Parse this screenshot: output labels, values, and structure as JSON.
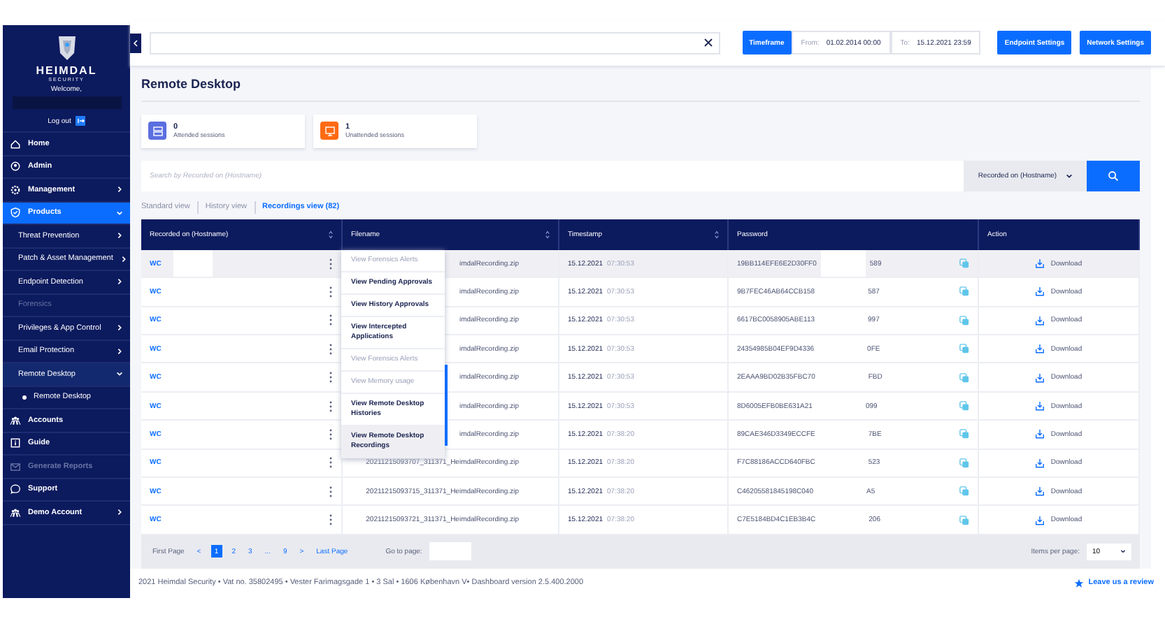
{
  "sidebar": {
    "brand": "HEIMDAL",
    "brand_sub": "SECURITY",
    "welcome": "Welcome,",
    "logout": "Log out",
    "items": [
      {
        "label": "Home",
        "selected": false,
        "disabled": false
      },
      {
        "label": "Admin",
        "selected": false,
        "disabled": false
      },
      {
        "label": "Management",
        "selected": false,
        "disabled": false,
        "expanded": false
      },
      {
        "label": "Products",
        "selected": true,
        "disabled": false,
        "expanded": true,
        "children": [
          {
            "label": "Threat Prevention",
            "selected": false,
            "disabled": false,
            "expanded": false
          },
          {
            "label": "Patch & Asset Management",
            "selected": false,
            "disabled": false,
            "expanded": false
          },
          {
            "label": "Endpoint Detection",
            "selected": false,
            "disabled": false,
            "expanded": false
          },
          {
            "label": "Forensics",
            "selected": false,
            "disabled": true
          },
          {
            "label": "Privileges & App Control",
            "selected": false,
            "disabled": false,
            "expanded": false
          },
          {
            "label": "Email Protection",
            "selected": false,
            "disabled": false,
            "expanded": false
          },
          {
            "label": "Remote Desktop",
            "selected": true,
            "disabled": false,
            "expanded": true,
            "children": [
              {
                "label": "Remote Desktop",
                "selected": true,
                "disabled": false
              }
            ]
          }
        ]
      },
      {
        "label": "Accounts",
        "selected": false,
        "disabled": false
      },
      {
        "label": "Guide",
        "selected": false,
        "disabled": false
      },
      {
        "label": "Generate Reports",
        "selected": false,
        "disabled": true
      },
      {
        "label": "Support",
        "selected": false,
        "disabled": false
      },
      {
        "label": "Demo Account",
        "selected": false,
        "disabled": false,
        "expanded": false
      }
    ]
  },
  "top_bar": {
    "timeframe": "Timeframe",
    "from_label": "From:",
    "from_value": "01.02.2014 00:00",
    "to_label": "To:",
    "to_value": "15.12.2021 23:59",
    "buttons": [
      "Endpoint Settings",
      "Network Settings"
    ]
  },
  "page_title": "Remote Desktop",
  "stats": [
    {
      "value": "0",
      "label": "Attended sessions",
      "color": "#5b6fe0"
    },
    {
      "value": "1",
      "label": "Unattended sessions",
      "color": "#ff6a13"
    }
  ],
  "search": {
    "placeholder": "Search by Recorded on (Hostname)",
    "filter": "Recorded on (Hostname)"
  },
  "tabs": [
    {
      "label": "Standard view",
      "selected": false
    },
    {
      "label": "History view",
      "selected": false
    },
    {
      "label": "Recordings view (82)",
      "selected": true
    }
  ],
  "table": {
    "columns": [
      "Recorded on (Hostname)",
      "Filename",
      "Timestamp",
      "Password",
      "Action"
    ],
    "rows": [
      {
        "hostname": "WC",
        "filename": "imdalRecording.zip",
        "date": "15.12.2021",
        "time": "07:30:53",
        "password_start": "19BB114EFE6E2D30FF0",
        "password_end": "589",
        "action": "Download",
        "highlighted": true
      },
      {
        "hostname": "WC",
        "filename": "imdalRecording.zip",
        "date": "15.12.2021",
        "time": "07:30:53",
        "password_start": "9B7FEC46AB64CCB158",
        "password_end": "587",
        "action": "Download",
        "highlighted": false
      },
      {
        "hostname": "WC",
        "filename": "imdalRecording.zip",
        "date": "15.12.2021",
        "time": "07:30:53",
        "password_start": "6617BC0058905ABE113",
        "password_end": "997",
        "action": "Download",
        "highlighted": false
      },
      {
        "hostname": "WC",
        "filename": "imdalRecording.zip",
        "date": "15.12.2021",
        "time": "07:30:53",
        "password_start": "24354985B04EF9D4336",
        "password_end": "0FE",
        "action": "Download",
        "highlighted": false
      },
      {
        "hostname": "WC",
        "filename": "imdalRecording.zip",
        "date": "15.12.2021",
        "time": "07:30:53",
        "password_start": "2EAAA9BD02B35FBC70",
        "password_end": "FBD",
        "action": "Download",
        "highlighted": false
      },
      {
        "hostname": "WC",
        "filename": "imdalRecording.zip",
        "date": "15.12.2021",
        "time": "07:30:53",
        "password_start": "8D6005EFB0BE631A21",
        "password_end": "099",
        "action": "Download",
        "highlighted": false
      },
      {
        "hostname": "WC",
        "filename": "imdalRecording.zip",
        "date": "15.12.2021",
        "time": "07:38:20",
        "password_start": "89CAE346D3349ECCFE",
        "password_end": "7BE",
        "action": "Download",
        "highlighted": false
      },
      {
        "hostname": "WC",
        "filename": "20211215093707_311371_HeimdalRecording.zip",
        "date": "15.12.2021",
        "time": "07:38:20",
        "password_start": "F7C88186ACCD640FBC",
        "password_end": "523",
        "action": "Download",
        "highlighted": false
      },
      {
        "hostname": "WC",
        "filename": "20211215093715_311371_HeimdalRecording.zip",
        "date": "15.12.2021",
        "time": "07:38:20",
        "password_start": "C46205581845198C040",
        "password_end": "A5",
        "action": "Download",
        "highlighted": false
      },
      {
        "hostname": "WC",
        "filename": "20211215093721_311371_HeimdalRecording.zip",
        "date": "15.12.2021",
        "time": "07:38:20",
        "password_start": "C7E5184BD4C1EB3B4C",
        "password_end": "206",
        "action": "Download",
        "highlighted": false
      }
    ]
  },
  "row_menu": [
    {
      "label": "View Forensics Alerts",
      "disabled": true,
      "selected": false
    },
    {
      "label": "View Pending Approvals",
      "disabled": false,
      "selected": false
    },
    {
      "label": "View History Approvals",
      "disabled": false,
      "selected": false
    },
    {
      "label": "View Intercepted Applications",
      "disabled": false,
      "selected": false
    },
    {
      "label": "View Forensics Alerts",
      "disabled": true,
      "selected": false
    },
    {
      "label": "View Memory usage",
      "disabled": true,
      "selected": false
    },
    {
      "label": "View Remote Desktop Histories",
      "disabled": false,
      "selected": false
    },
    {
      "label": "View Remote Desktop Recordings",
      "disabled": false,
      "selected": true
    }
  ],
  "pagination": {
    "first": "First Page",
    "prev": "<",
    "pages": [
      {
        "label": "1",
        "selected": true
      },
      {
        "label": "2",
        "selected": false
      },
      {
        "label": "3",
        "selected": false
      },
      {
        "label": "...",
        "selected": false
      },
      {
        "label": "9",
        "selected": false
      }
    ],
    "next": ">",
    "last": "Last Page",
    "goto_label": "Go to page:",
    "per_page_label": "Items per page:",
    "per_page": "10"
  },
  "footer": {
    "text": "2021 Heimdal Security • Vat no. 35802495 • Vester Farimagsgade 1 • 3 Sal • 1606 København V• Dashboard version 2.5.400.2000",
    "review": "Leave us a review"
  }
}
